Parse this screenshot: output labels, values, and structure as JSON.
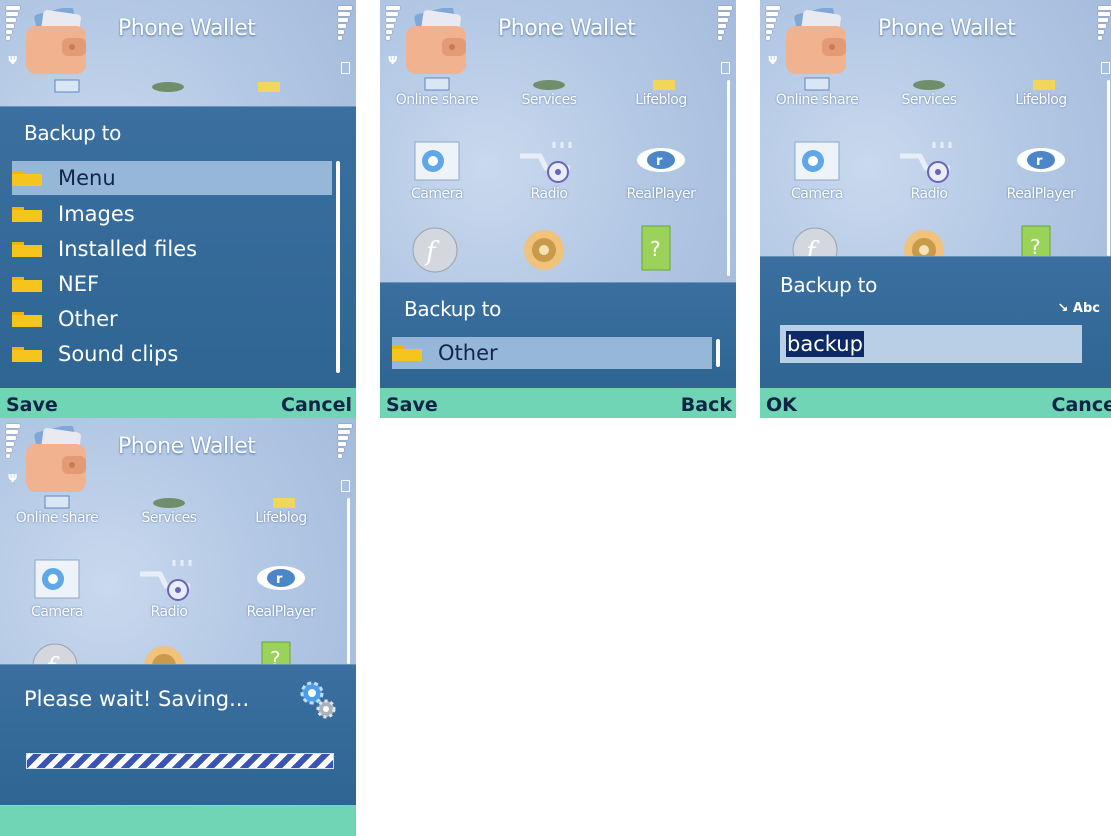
{
  "app_title": "Phone Wallet",
  "grid_labels": [
    "Online share",
    "Services",
    "Lifeblog",
    "Camera",
    "Radio",
    "RealPlayer"
  ],
  "screen1": {
    "dialog_title": "Backup to",
    "items": [
      "Menu",
      "Images",
      "Installed files",
      "NEF",
      "Other",
      "Sound clips"
    ],
    "selected_index": 0,
    "softkey_left": "Save",
    "softkey_right": "Cancel"
  },
  "screen2": {
    "dialog_title": "Backup to",
    "item": "Other",
    "softkey_left": "Save",
    "softkey_right": "Back"
  },
  "screen3": {
    "dialog_title": "Backup to",
    "input_value": "backup",
    "input_mode": "Abc",
    "softkey_left": "OK",
    "softkey_right": "Cance"
  },
  "screen4": {
    "message": "Please wait! Saving...",
    "progress": 1.0
  },
  "colors": {
    "dialog": "#3a6f9f",
    "softbar": "#6fd5b5",
    "selection": "#97b7d9",
    "folder": "#f6c51d"
  }
}
